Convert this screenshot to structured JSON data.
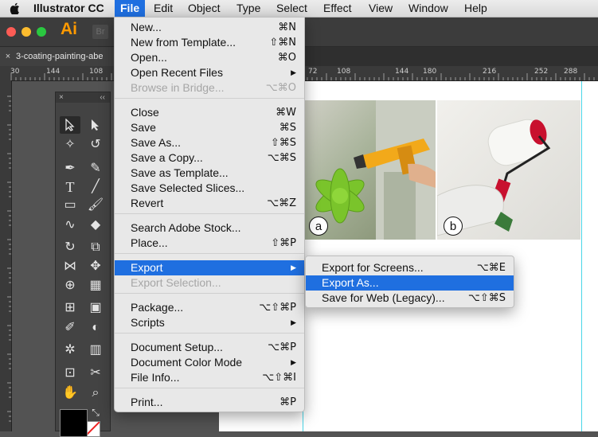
{
  "menubar": {
    "apple": "",
    "app": "Illustrator CC",
    "items": [
      "File",
      "Edit",
      "Object",
      "Type",
      "Select",
      "Effect",
      "View",
      "Window",
      "Help"
    ]
  },
  "titlebar": {
    "app_icon": "Ai",
    "bridge_icon": "Br"
  },
  "document_tab": {
    "close": "×",
    "title": "3-coating-painting-abe"
  },
  "ruler": {
    "h_numbers": [
      "30",
      "144",
      "108",
      "72",
      "108",
      "144",
      "180",
      "216",
      "252",
      "288"
    ]
  },
  "tools": [
    "select",
    "direct-select",
    "magic-wand",
    "lasso",
    "pen",
    "curvature",
    "type",
    "line",
    "rectangle",
    "paintbrush",
    "shaper",
    "eraser",
    "rotate",
    "scale",
    "warp",
    "free-transform",
    "shape-builder",
    "perspective",
    "mesh",
    "gradient",
    "eyedropper",
    "blend",
    "symbol-sprayer",
    "column-graph",
    "artboard",
    "slice",
    "hand",
    "zoom"
  ],
  "photos": {
    "a_label": "a",
    "b_label": "b"
  },
  "file_menu": [
    {
      "label": "New...",
      "shortcut": "⌘N"
    },
    {
      "label": "New from Template...",
      "shortcut": "⇧⌘N"
    },
    {
      "label": "Open...",
      "shortcut": "⌘O"
    },
    {
      "label": "Open Recent Files",
      "shortcut": "▶"
    },
    {
      "label": "Browse in Bridge...",
      "shortcut": "⌥⌘O"
    },
    {
      "label": "Close",
      "shortcut": "⌘W"
    },
    {
      "label": "Save",
      "shortcut": "⌘S"
    },
    {
      "label": "Save As...",
      "shortcut": "⇧⌘S"
    },
    {
      "label": "Save a Copy...",
      "shortcut": "⌥⌘S"
    },
    {
      "label": "Save as Template...",
      "shortcut": ""
    },
    {
      "label": "Save Selected Slices...",
      "shortcut": ""
    },
    {
      "label": "Revert",
      "shortcut": "⌥⌘Z"
    },
    {
      "label": "Search Adobe Stock...",
      "shortcut": ""
    },
    {
      "label": "Place...",
      "shortcut": "⇧⌘P"
    },
    {
      "label": "Export",
      "shortcut": "▶"
    },
    {
      "label": "Export Selection...",
      "shortcut": ""
    },
    {
      "label": "Package...",
      "shortcut": "⌥⇧⌘P"
    },
    {
      "label": "Scripts",
      "shortcut": "▶"
    },
    {
      "label": "Document Setup...",
      "shortcut": "⌥⌘P"
    },
    {
      "label": "Document Color Mode",
      "shortcut": "▶"
    },
    {
      "label": "File Info...",
      "shortcut": "⌥⇧⌘I"
    },
    {
      "label": "Print...",
      "shortcut": "⌘P"
    }
  ],
  "export_menu": [
    {
      "label": "Export for Screens...",
      "shortcut": "⌥⌘E"
    },
    {
      "label": "Export As...",
      "shortcut": ""
    },
    {
      "label": "Save for Web (Legacy)...",
      "shortcut": "⌥⇧⌘S"
    }
  ],
  "colors": {
    "highlight": "#1f6fe0",
    "guide": "#49d6e8",
    "ai_orange": "#ff9a00"
  }
}
